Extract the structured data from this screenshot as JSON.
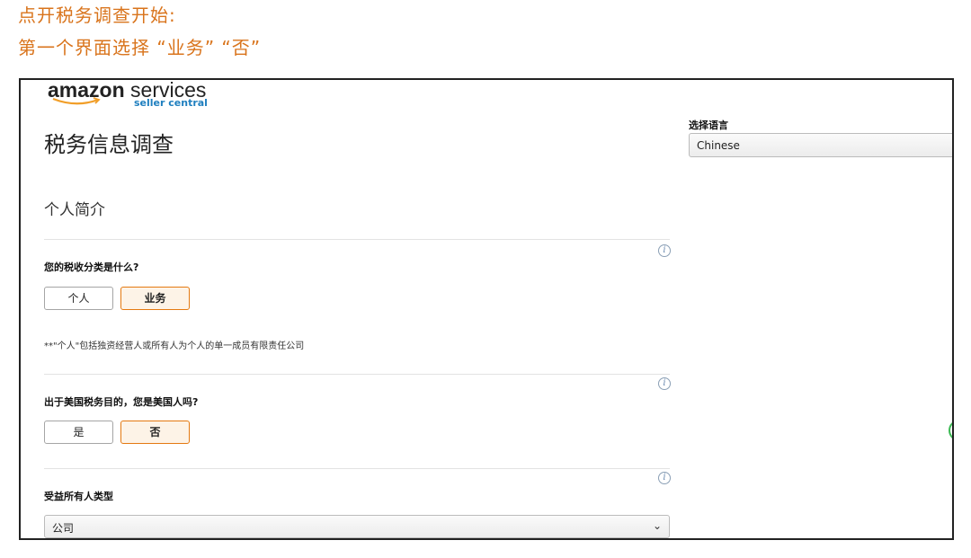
{
  "caption": {
    "line1": "点开税务调查开始:",
    "line2": "第一个界面选择 “业务” “否”"
  },
  "logo": {
    "brand": "amazon",
    "product": "services",
    "sub": "seller central"
  },
  "page_title": "税务信息调查",
  "language": {
    "label": "选择语言",
    "selected": "Chinese"
  },
  "section_title": "个人简介",
  "tax_class": {
    "question": "您的税收分类是什么?",
    "options": [
      "个人",
      "业务"
    ],
    "selected": "业务",
    "note": "**\"个人\"包括独资经营人或所有人为个人的单一成员有限责任公司"
  },
  "us_person": {
    "question": "出于美国税务目的，您是美国人吗?",
    "options": [
      "是",
      "否"
    ],
    "selected": "否"
  },
  "beneficial_owner": {
    "label": "受益所有人类型",
    "selected": "公司"
  },
  "icons": {
    "info": "info-icon",
    "chevron": "chevron-down-icon"
  },
  "colors": {
    "caption": "#d9741c",
    "selected_border": "#e47911",
    "selected_bg": "#fdf3e7",
    "link": "#1f7fbf"
  }
}
